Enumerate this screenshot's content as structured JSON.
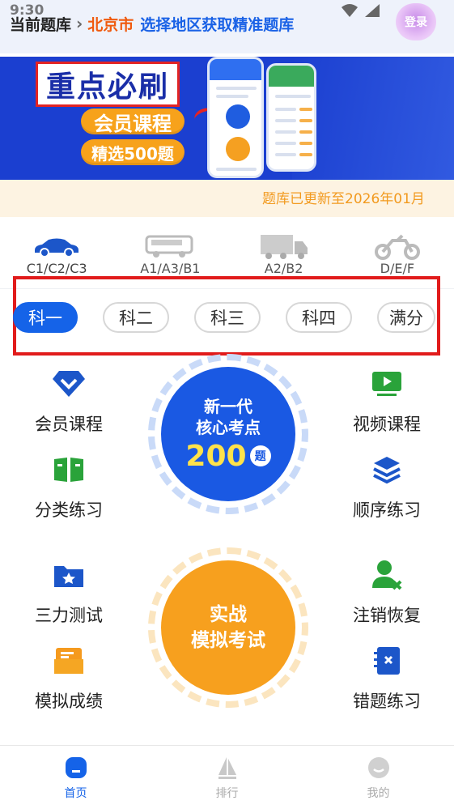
{
  "status": {
    "time": "9:30"
  },
  "header": {
    "current_bank_label": "当前题库",
    "city": "北京市",
    "region_prompt": "选择地区获取精准题库",
    "login_label": "登录"
  },
  "banner": {
    "title": "重点必刷",
    "pill1": "会员课程",
    "pill2": "精选500题"
  },
  "notice": {
    "text": "题库已更新至2026年01月"
  },
  "license_types": [
    {
      "label": "C1/C2/C3",
      "icon": "car-icon"
    },
    {
      "label": "A1/A3/B1",
      "icon": "bus-icon"
    },
    {
      "label": "A2/B2",
      "icon": "truck-icon"
    },
    {
      "label": "D/E/F",
      "icon": "motorcycle-icon"
    }
  ],
  "subjects": {
    "tabs": [
      "科一",
      "科二",
      "科三",
      "科四",
      "满分"
    ],
    "active_index": 0
  },
  "features": {
    "left": [
      "会员课程",
      "分类练习",
      "三力测试",
      "模拟成绩"
    ],
    "right": [
      "视频课程",
      "顺序练习",
      "注销恢复",
      "错题练习"
    ]
  },
  "core_points": {
    "line1": "新一代",
    "line2": "核心考点",
    "number": "200",
    "unit": "题"
  },
  "mock_exam": {
    "line1": "实战",
    "line2": "模拟考试"
  },
  "bottom_nav": {
    "items": [
      "首页",
      "排行",
      "我的"
    ],
    "active_index": 0
  },
  "colors": {
    "primary": "#1563e8",
    "accent_orange": "#f7a01e",
    "highlight_red": "#e11b1b",
    "city_orange": "#f05a0e"
  }
}
